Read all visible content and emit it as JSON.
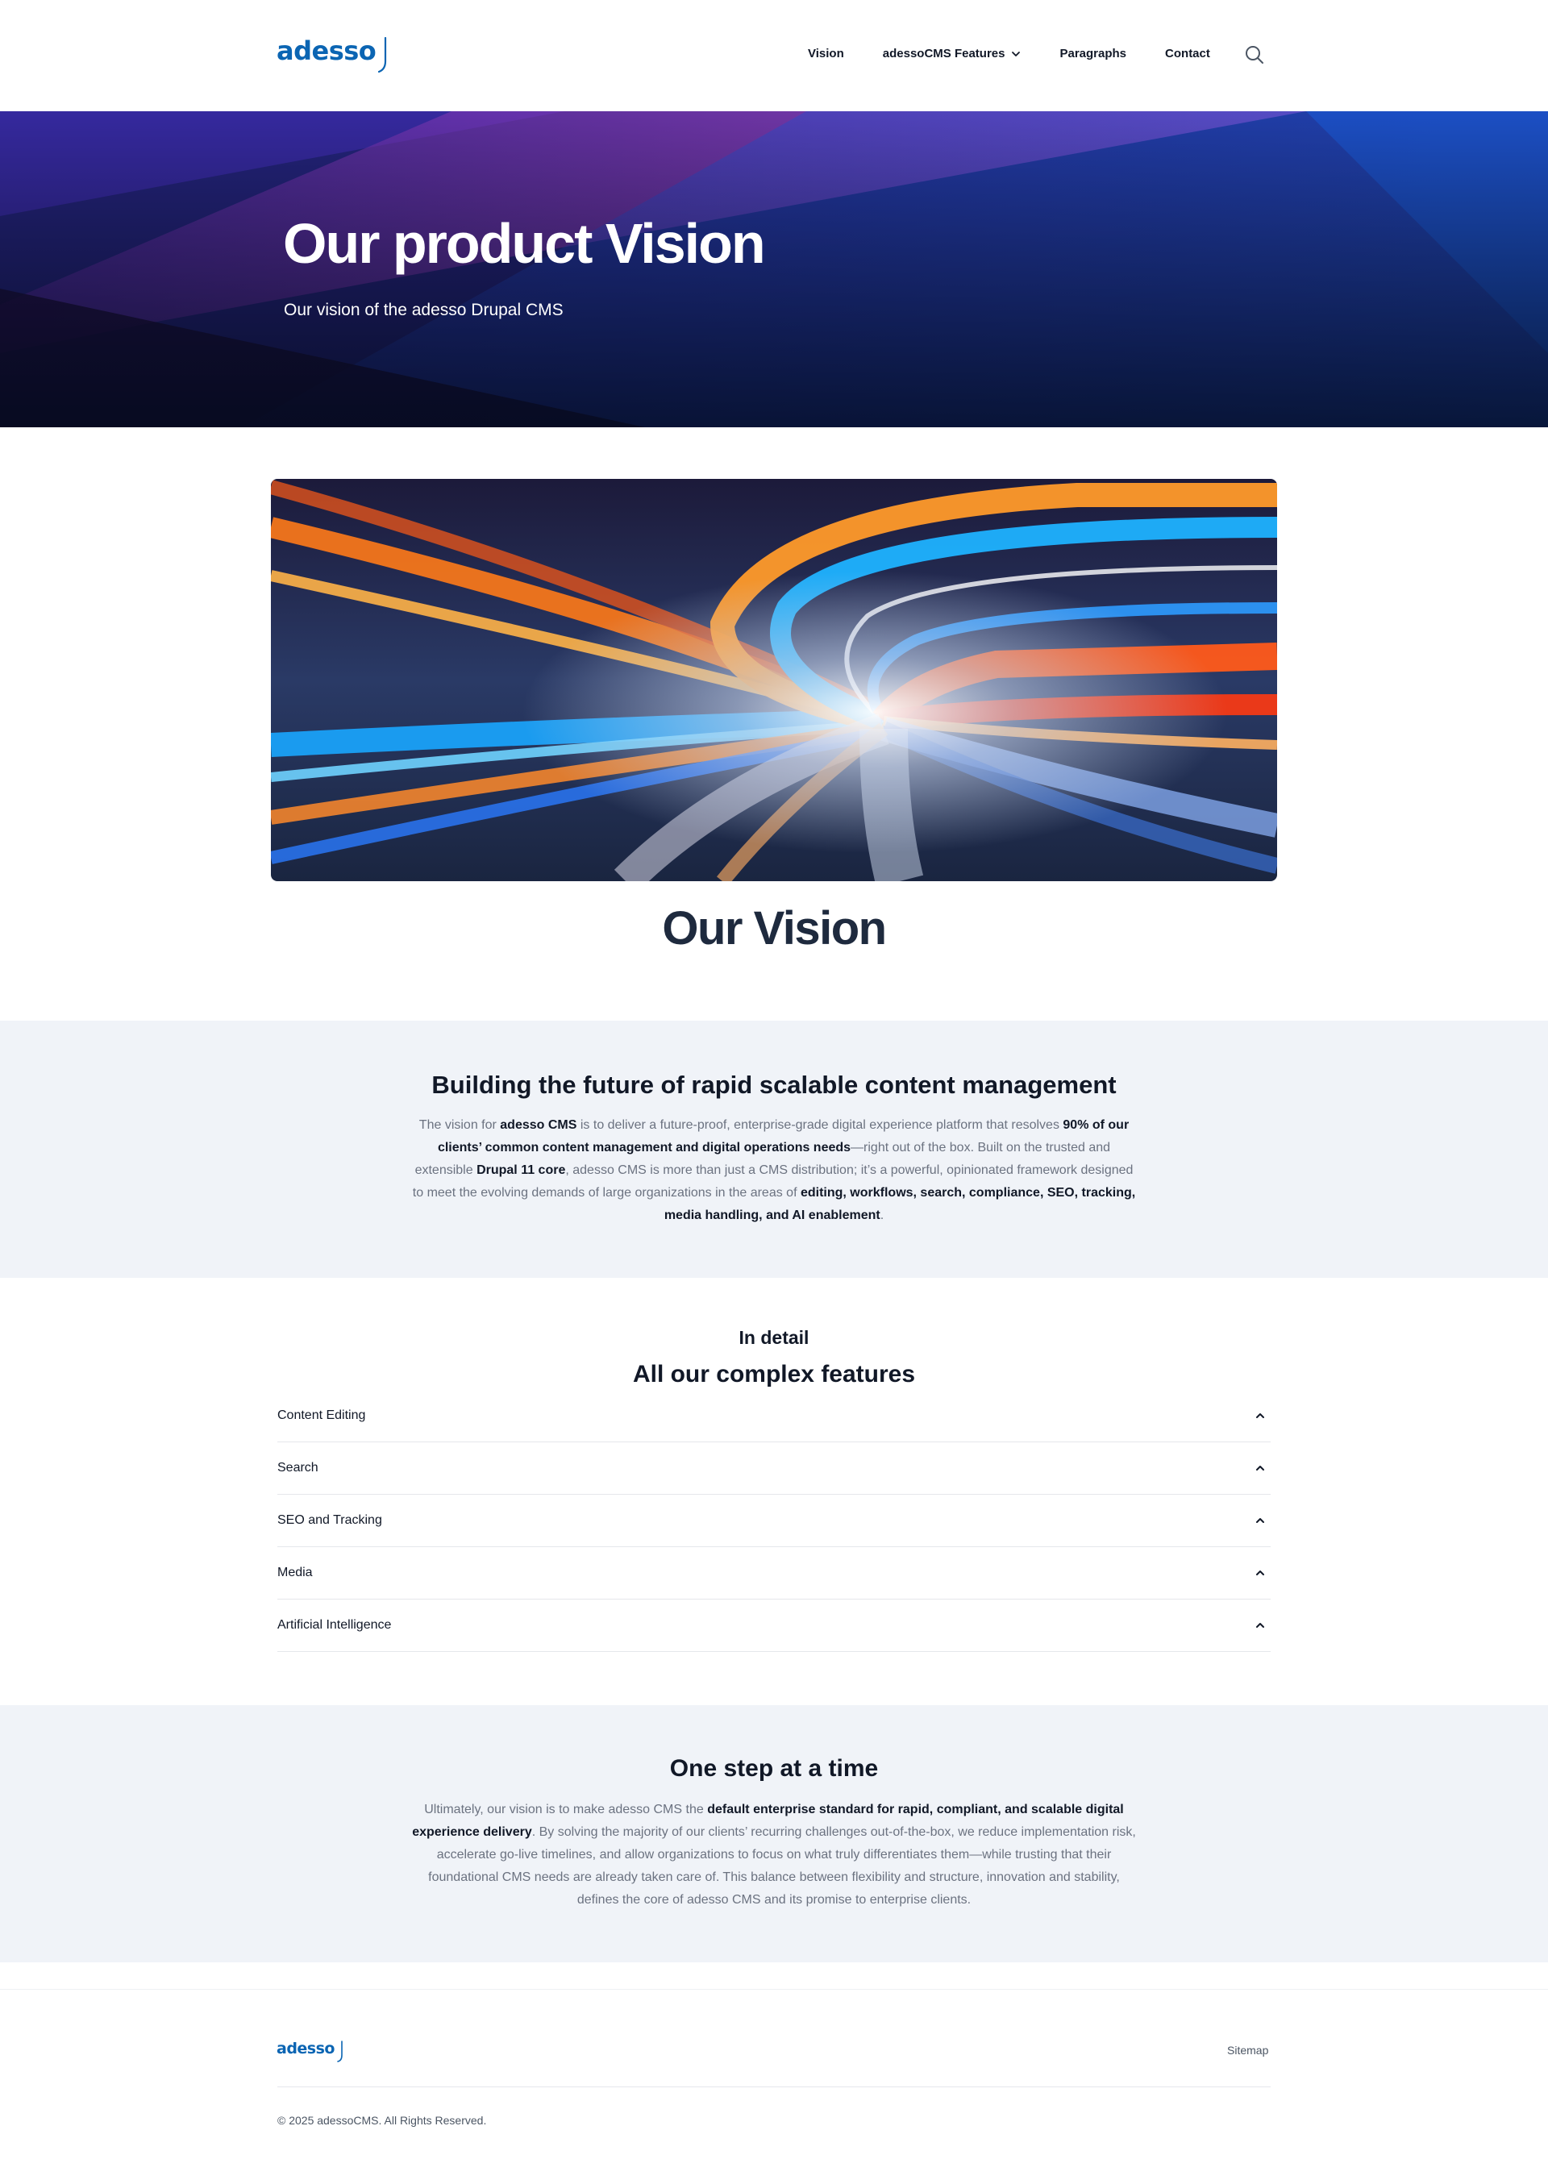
{
  "header": {
    "logo_text": "adesso",
    "nav": [
      {
        "label": "Vision"
      },
      {
        "label": "adessoCMS Features"
      },
      {
        "label": "Paragraphs"
      },
      {
        "label": "Contact"
      }
    ]
  },
  "hero": {
    "title": "Our product Vision",
    "subtitle": "Our vision of the adesso Drupal CMS"
  },
  "vision": {
    "heading": "Our Vision"
  },
  "intro": {
    "heading": "Building the future of rapid scalable content management",
    "p1": "The vision for ",
    "b1": "adesso CMS",
    "p2": " is to deliver a future-proof, enterprise-grade digital experience platform that resolves ",
    "b2": "90% of our clients’ common content management and digital operations needs",
    "p3": "—right out of the box. Built on the trusted and extensible ",
    "b3": "Drupal 11 core",
    "p4": ", adesso CMS is more than just a CMS distribution; it’s a powerful, opinionated framework designed to meet the evolving demands of large organizations in the areas of ",
    "b4": "editing, workflows, search, compliance, SEO, tracking, media handling, and AI enablement",
    "p5": "."
  },
  "features": {
    "eyebrow": "In detail",
    "heading": "All our complex features",
    "items": [
      {
        "label": "Content Editing"
      },
      {
        "label": "Search"
      },
      {
        "label": "SEO and Tracking"
      },
      {
        "label": "Media"
      },
      {
        "label": "Artificial Intelligence"
      }
    ]
  },
  "outro": {
    "heading": "One step at a time",
    "p1": "Ultimately, our vision is to make adesso CMS the ",
    "b1": "default enterprise standard for rapid, compliant, and scalable digital experience delivery",
    "p2": ". By solving the majority of our clients’ recurring challenges out-of-the-box, we reduce implementation risk, accelerate go-live timelines, and allow organizations to focus on what truly differentiates them—while trusting that their foundational CMS needs are already taken care of. This balance between flexibility and structure, innovation and stability, defines the core of adesso CMS and its promise to enterprise clients."
  },
  "footer": {
    "logo_text": "adesso",
    "sitemap": "Sitemap",
    "copyright": "© 2025 adessoCMS. All Rights Reserved."
  },
  "colors": {
    "brand": "#0b65b3",
    "band_bg": "#f0f3f8",
    "heading": "#1e2a3e"
  }
}
